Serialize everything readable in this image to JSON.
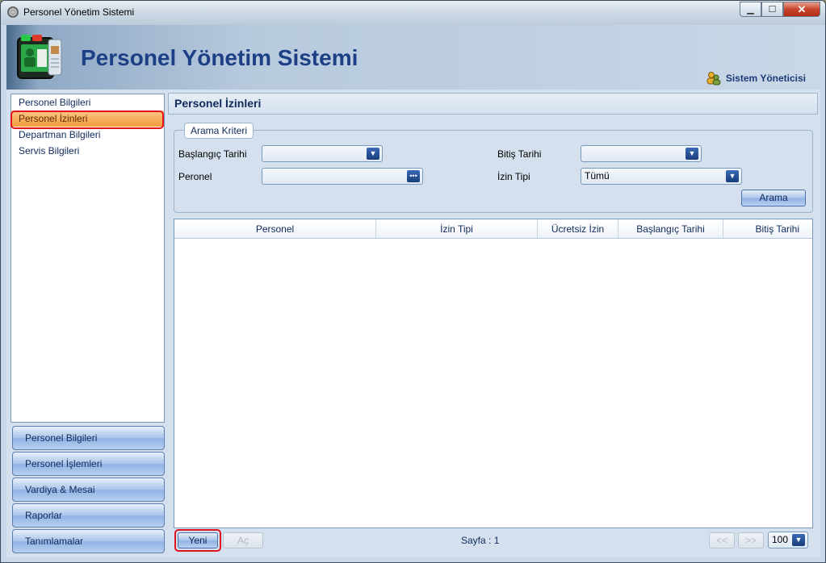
{
  "window": {
    "title": "Personel Yönetim Sistemi"
  },
  "header": {
    "app_title": "Personel Yönetim Sistemi",
    "user": "Sistem Yöneticisi"
  },
  "sidebar": {
    "items": [
      {
        "label": "Personel Bilgileri"
      },
      {
        "label": "Personel İzinleri"
      },
      {
        "label": "Departman Bilgileri"
      },
      {
        "label": "Servis Bilgileri"
      }
    ],
    "selected": "Personel İzinleri"
  },
  "nav_buttons": [
    {
      "label": "Personel Bilgileri"
    },
    {
      "label": "Personel İşlemleri"
    },
    {
      "label": "Vardiya & Mesai"
    },
    {
      "label": "Raporlar"
    },
    {
      "label": "Tanımlamalar"
    }
  ],
  "panel": {
    "title": "Personel İzinleri",
    "search": {
      "group_title": "Arama Kriteri",
      "start_date_label": "Başlangıç Tarihi",
      "start_date_value": "",
      "end_date_label": "Bitiş Tarihi",
      "end_date_value": "",
      "personnel_label": "Peronel",
      "personnel_value": "",
      "leave_type_label": "İzin Tipi",
      "leave_type_value": "Tümü",
      "search_button": "Arama"
    },
    "grid": {
      "columns": [
        "Personel",
        "İzin Tipi",
        "Ücretsiz İzin",
        "Başlangıç Tarihi",
        "Bitiş Tarihi"
      ],
      "rows": []
    },
    "footer": {
      "new_button": "Yeni",
      "open_button": "Aç",
      "page_info": "Sayfa : 1",
      "prev": "<<",
      "next": ">>",
      "page_size": "100"
    }
  },
  "colors": {
    "accent": "#1c3f86",
    "selection": "#f39a3a",
    "highlight_box": "#e0141e"
  }
}
